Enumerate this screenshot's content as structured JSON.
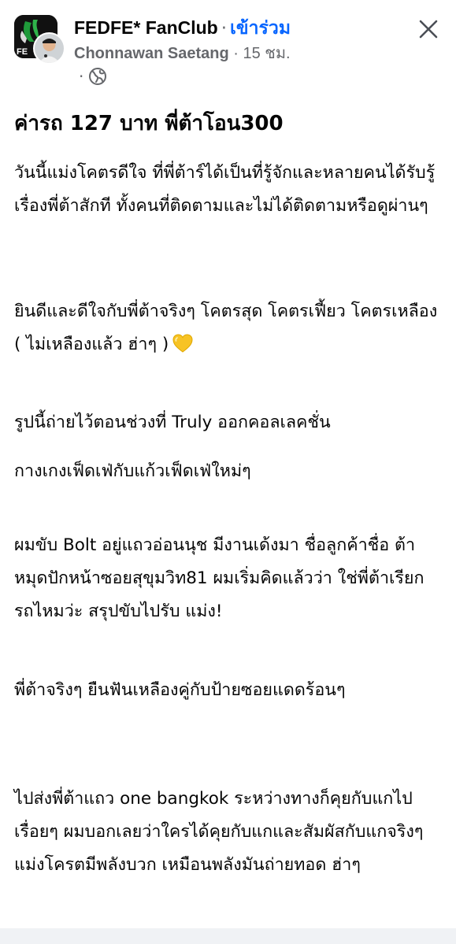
{
  "header": {
    "group_name": "FEDFE* FanClub",
    "separator": "·",
    "join_label": "เข้าร่วม",
    "author": "Chonnawan Saetang",
    "time": "15 ชม.",
    "privacy_icon": "globe-icon",
    "close_icon": "close-icon"
  },
  "post": {
    "title": "ค่ารถ 127 บาท พี่ต้าโอน300",
    "paragraphs": [
      "วันนี้แม่งโคตรดีใจ ที่พี่ต้าร์ได้เป็นที่รู้จักและหลายคนได้รับรู้เรื่องพี่ต้าสักที ทั้งคนที่ติดตามและไม่ได้ติดตามหรือดูผ่านๆ",
      "ยินดีและดีใจกับพี่ต้าจริงๆ โคตรสุด โคตรเฟี้ยว โคตรเหลือง ( ไม่เหลืองแล้ว ฮ่าๆ )",
      "รูปนี้ถ่ายไว้ตอนช่วงที่ Truly ออกคอลเลคชั่น",
      "กางเกงเฟ็ดเฟ่กับแก้วเฟ็ดเฟ่ใหม่ๆ",
      "ผมขับ Bolt อยู่แถวอ่อนนุช มีงานเด้งมา ชื่อลูกค้าชื่อ ต้า หมุดปักหน้าซอยสุขุมวิท81 ผมเริ่มคิดแล้วว่า ใช่พี่ต้าเรียกรถไหมว่ะ สรุปขับไปรับ แม่ง!",
      "พี่ต้าจริงๆ ยืนฟันเหลืองคู่กับป้ายซอยแดดร้อนๆ",
      "ไปส่งพี่ต้าแถว one bangkok ระหว่างทางก็คุยกับแกไปเรื่อยๆ ผมบอกเลยว่าใครได้คุยกับแกและสัมผัสกับแกจริงๆแม่งโครตมีพลังบวก เหมือนพลังมันถ่ายทอด ฮ่าๆ"
    ],
    "emoji": "yellow-heart-icon"
  },
  "colors": {
    "link_blue": "#0866ff",
    "secondary_text": "#65676b",
    "primary_text": "#050505",
    "heart_yellow": "#f7c325"
  }
}
